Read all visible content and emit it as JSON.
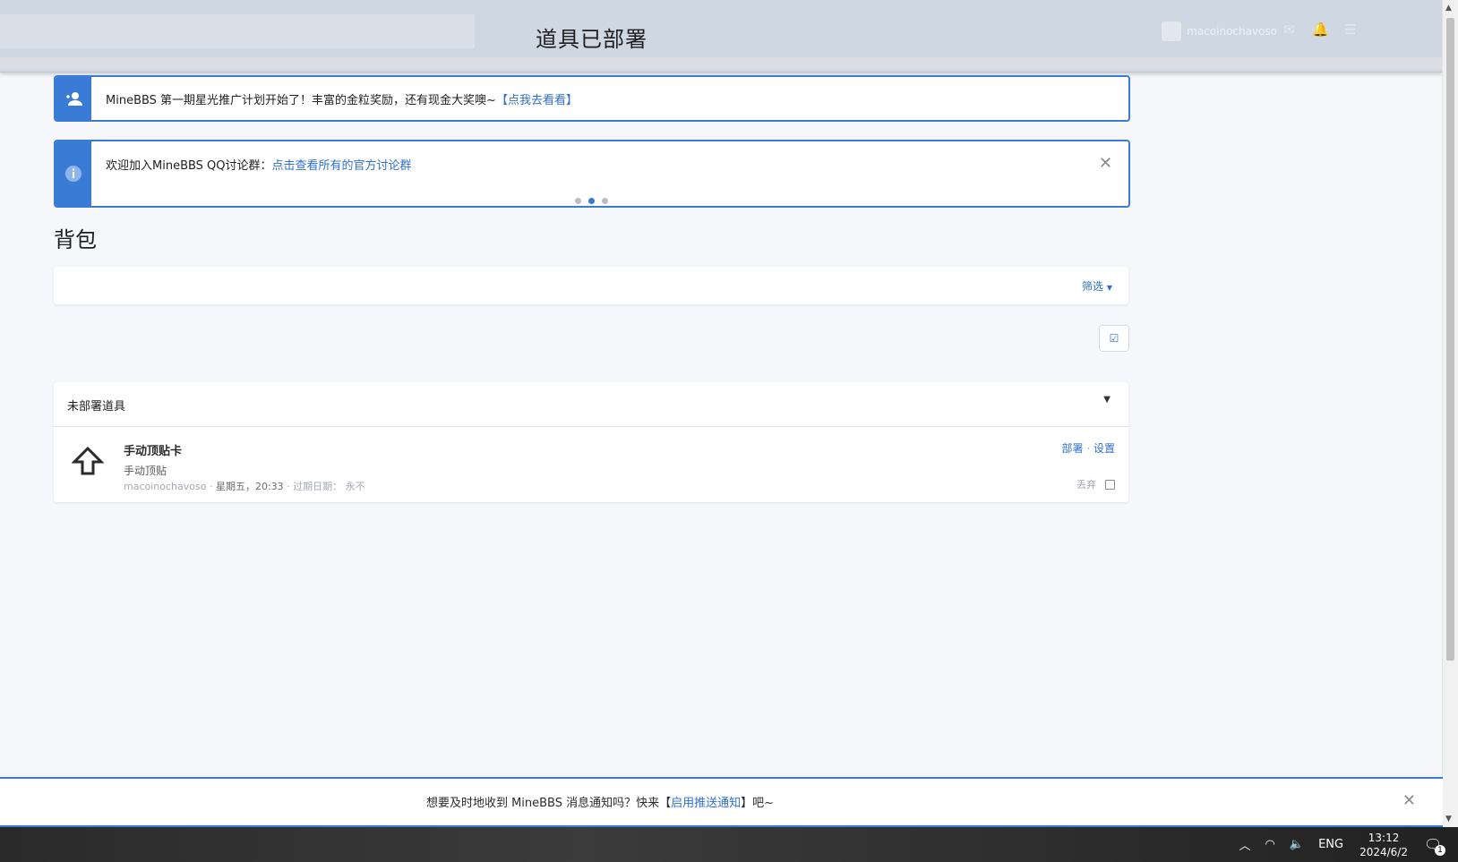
{
  "header": {
    "title": "道具已部署",
    "username": "macoinochavoso"
  },
  "notices": [
    {
      "text": "MineBBS 第一期星光推广计划开始了！丰富的金粒奖励，还有现金大奖噢~",
      "link": "【点我去看看】"
    },
    {
      "text": "欢迎加入MineBBS QQ讨论群：",
      "link": "点击查看所有的官方讨论群"
    }
  ],
  "page_title": "背包",
  "filter_label": "筛选",
  "panel": {
    "header": "未部署道具",
    "item": {
      "name": "手动顶贴卡",
      "description": "手动顶贴",
      "user": "macoinochavoso",
      "date": "星期五，20:33",
      "expiry_label": "过期日期：",
      "expiry_value": "永不",
      "deploy_label": "部署",
      "separator": "·",
      "settings_label": "设置",
      "discard_label": "丢弃"
    }
  },
  "push_bar": {
    "prefix": "想要及时地收到 MineBBS 消息通知吗？快来【",
    "link": "启用推送通知",
    "suffix": "】吧~"
  },
  "taskbar": {
    "lang": "ENG",
    "time": "13:12",
    "date": "2024/6/2",
    "notif_count": "1"
  },
  "colors": {
    "accent": "#3a7bd5",
    "link": "#2f6fd0",
    "header_bg": "#cfd7e3"
  }
}
